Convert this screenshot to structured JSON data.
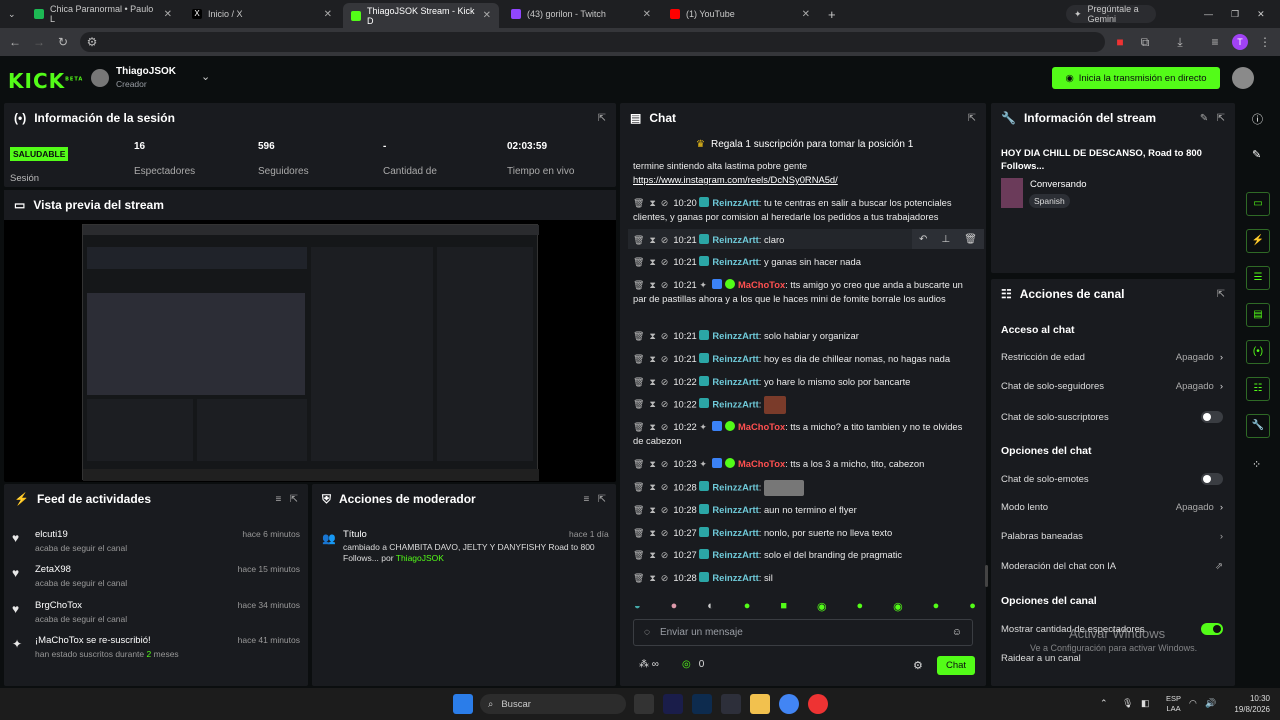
{
  "browser": {
    "tabs": [
      {
        "label": "Chica Paranormal • Paulo L",
        "active": false
      },
      {
        "label": "Inicio / X",
        "active": false
      },
      {
        "label": "ThiagoJSOK Stream - Kick D",
        "active": true
      },
      {
        "label": "(43) gorilon - Twitch",
        "active": false
      },
      {
        "label": "(1) YouTube",
        "active": false
      }
    ],
    "new_tab": "+",
    "gemini": "Pregúntale a Gemini",
    "profile_initial": "T"
  },
  "header": {
    "logo": "KICK",
    "logo_sup": "BETA",
    "user_name": "ThiagoJSOK",
    "user_role": "Creador",
    "go_live": "Inicia la transmisión en directo"
  },
  "session": {
    "title": "Información de la sesión",
    "status_badge": "SALUDABLE",
    "status_label": "Sesión",
    "viewers": "16",
    "viewers_label": "Espectadores",
    "followers": "596",
    "followers_label": "Seguidores",
    "subs": "-",
    "subs_label": "Cantidad de",
    "time": "02:03:59",
    "time_label": "Tiempo en vivo"
  },
  "preview": {
    "title": "Vista previa del stream"
  },
  "feed": {
    "title": "Feed de actividades",
    "items": [
      {
        "user": "elcuti19",
        "action": "acaba de seguir el canal",
        "time": "hace 6 minutos"
      },
      {
        "user": "ZetaX98",
        "action": "acaba de seguir el canal",
        "time": "hace 15 minutos"
      },
      {
        "user": "BrgChoTox",
        "action": "acaba de seguir el canal",
        "time": "hace 34 minutos"
      },
      {
        "user": "¡MaChoTox se re-suscribió!",
        "action": "han estado suscritos durante",
        "count": "2",
        "unit": "meses",
        "time": "hace 41 minutos"
      }
    ]
  },
  "mod": {
    "title": "Acciones de moderador",
    "item_title": "Título",
    "item_time": "hace 1 día",
    "item_body": "cambiado a CHAMBITA DAVO, JELTY Y DANYFISHY Road to 800 Follows... por",
    "item_by": "ThiagoJSOK"
  },
  "chat": {
    "title": "Chat",
    "pinned": "Regala 1 suscripción para tomar la posición 1",
    "prev_text": "termine sintiendo alta lastima pobre gente",
    "prev_link": "https://www.instagram.com/reels/DcNSy0RNA5d/",
    "messages": [
      {
        "time": "10:20",
        "user": "ReinzzArtt",
        "text": "tu te centras en salir a buscar los potenciales clientes, y ganas por comision al heredarle los pedidos a tus trabajadores",
        "red": false
      },
      {
        "time": "10:21",
        "user": "ReinzzArtt",
        "text": "claro",
        "red": false
      },
      {
        "time": "10:21",
        "user": "ReinzzArtt",
        "text": "y ganas sin hacer nada",
        "red": false
      },
      {
        "time": "10:21",
        "user": "MaChoTox",
        "text": "tts amigo yo creo que anda a buscarte un par de pastillas ahora y a los que le haces mini de fomite borrale los audios",
        "red": true
      },
      {
        "time": "10:21",
        "user": "ReinzzArtt",
        "text": "solo habiar y organizar",
        "red": false
      },
      {
        "time": "10:21",
        "user": "ReinzzArtt",
        "text": "hoy es dia de chillear nomas, no hagas nada",
        "red": false
      },
      {
        "time": "10:22",
        "user": "ReinzzArtt",
        "text": "yo hare lo mismo solo por bancarte",
        "red": false
      },
      {
        "time": "10:22",
        "user": "ReinzzArtt",
        "text": "",
        "red": false
      },
      {
        "time": "10:22",
        "user": "MaChoTox",
        "text": "tts a micho? a tito tambien y no te olvides de cabezon",
        "red": true
      },
      {
        "time": "10:23",
        "user": "MaChoTox",
        "text": "tts a los 3 a micho, tito, cabezon",
        "red": true
      },
      {
        "time": "10:28",
        "user": "ReinzzArtt",
        "text": "",
        "red": false
      },
      {
        "time": "10:28",
        "user": "ReinzzArtt",
        "text": "aun no termino el flyer",
        "red": false
      },
      {
        "time": "10:27",
        "user": "ReinzzArtt",
        "text": "nonlo, por suerte no lleva texto",
        "red": false
      },
      {
        "time": "10:27",
        "user": "ReinzzArtt",
        "text": "solo el del branding de pragmatic",
        "red": false
      },
      {
        "time": "10:28",
        "user": "ReinzzArtt",
        "text": "sil",
        "red": false
      }
    ],
    "input_placeholder": "Enviar un mensaje",
    "points": "0",
    "send": "Chat"
  },
  "stream_info": {
    "title": "Información del stream",
    "stream_title": "HOY DIA CHILL DE DESCANSO, Road to 800 Follows...",
    "category": "Conversando",
    "language": "Spanish"
  },
  "channel": {
    "title": "Acciones de canal",
    "chat_access": "Acceso al chat",
    "age": "Restricción de edad",
    "age_val": "Apagado",
    "followers_only": "Chat de solo-seguidores",
    "followers_val": "Apagado",
    "subs_only": "Chat de solo-suscriptores",
    "chat_options": "Opciones del chat",
    "emotes_only": "Chat de solo-emotes",
    "slow": "Modo lento",
    "slow_val": "Apagado",
    "banned": "Palabras baneadas",
    "ai_mod": "Moderación del chat con IA",
    "channel_options": "Opciones del canal",
    "show_viewers": "Mostrar cantidad de espectadores",
    "raid": "Raidear a un canal"
  },
  "watermark": {
    "line1": "Activar Windows",
    "line2": "Ve a Configuración para activar Windows."
  },
  "taskbar": {
    "search": "Buscar",
    "lang1": "ESP",
    "lang2": "LAA",
    "time": "10:30",
    "date": "19/8/2026"
  }
}
